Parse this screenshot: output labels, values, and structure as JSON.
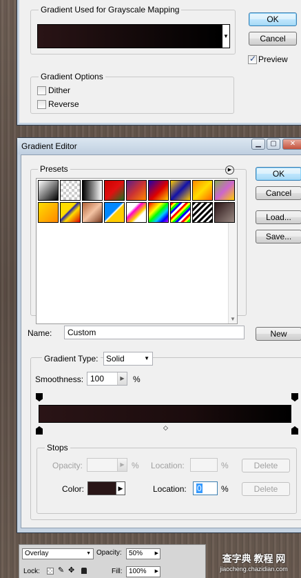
{
  "gradient_map": {
    "group_gradient": "Gradient Used for Grayscale Mapping",
    "group_options": "Gradient Options",
    "dither": "Dither",
    "reverse": "Reverse",
    "ok": "OK",
    "cancel": "Cancel",
    "preview": "Preview",
    "preview_checked": true
  },
  "gradient_editor": {
    "title": "Gradient Editor",
    "presets_label": "Presets",
    "ok": "OK",
    "cancel": "Cancel",
    "load": "Load...",
    "save": "Save...",
    "name_label": "Name:",
    "name_value": "Custom",
    "new": "New",
    "gradient_type_label": "Gradient Type:",
    "gradient_type_value": "Solid",
    "smoothness_label": "Smoothness:",
    "smoothness_value": "100",
    "percent": "%",
    "stops_label": "Stops",
    "opacity_label": "Opacity:",
    "opacity_value": "",
    "location_label": "Location:",
    "location_opacity_value": "",
    "delete": "Delete",
    "color_label": "Color:",
    "color_value": "#2a1617",
    "location_color_value": "0",
    "gradient_start": "#2a1416",
    "gradient_end": "#000000"
  },
  "presets": [
    [
      "linear-gradient(135deg,#fff 0%,#000 100%)",
      "foreground-to-transparent"
    ],
    [
      "repeating-conic-gradient(#ccc 0 25%,#fff 0 50%) 0 0/8px 8px",
      "transparent"
    ],
    [
      "linear-gradient(90deg,#000,#fff)",
      "black-white"
    ],
    [
      "linear-gradient(135deg,#c00 0%,#e01010 50%,#1f6e1f 100%)",
      "red-green"
    ],
    [
      "linear-gradient(135deg,#5a1e8a 0%,#c33 50%,#f80 100%)",
      "violet-orange"
    ],
    [
      "linear-gradient(135deg,#20a 0%,#d00 55%,#fc0 100%)",
      "blue-red-yellow"
    ],
    [
      "linear-gradient(135deg,#fc0 0%,#11a 50%,#fc0 100%)",
      "blue-yellow-blue"
    ],
    [
      "linear-gradient(135deg,#f80 0%,#fd0 50%,#f60 100%)",
      "orange-yellow"
    ],
    [
      "linear-gradient(135deg,#8a5 0%,#c6c 50%,#fc0 100%)",
      "violet-green"
    ],
    [
      "linear-gradient(135deg,#fd0 0%,#f80 100%)",
      "yellow-violet"
    ],
    [
      "linear-gradient(135deg,#fd0 0%,#fd0 40%,#22a 45%,#fd0 60%,#d00 100%)",
      "spectrum-yellow"
    ],
    [
      "linear-gradient(135deg,#b5653a 0%,#f3c2a2 50%,#7a3a20 100%)",
      "copper"
    ],
    [
      "linear-gradient(135deg,#08f 0%,#08f 45%,#fff 50%,#fc0 55%,#fc0 100%)",
      "chrome"
    ],
    [
      "linear-gradient(135deg,#fff 30%,#f0c 40%,#fc0 60%,#fff 70%)",
      "spectrum-light"
    ],
    [
      "linear-gradient(135deg,#f00,#f80,#ff0,#0f0,#0cf,#00f,#c0f)",
      "spectrum"
    ],
    [
      "repeating-linear-gradient(135deg,#f00 0 3px,#ff0 3px 6px,#0f0 6px 9px,#00f 9px 12px,#fff 12px 15px)",
      "rainbow-stripes"
    ],
    [
      "repeating-linear-gradient(135deg,#000 0 3px,#fff 3px 6px)",
      "stripes"
    ],
    [
      "linear-gradient(135deg,#2a1416 0%,#9a8a84 100%)",
      "custom"
    ]
  ],
  "layers": {
    "blend_mode": "Overlay",
    "opacity_label": "Opacity:",
    "opacity_value": "50%",
    "lock_label": "Lock:",
    "fill_label": "Fill:",
    "fill_value": "100%"
  },
  "watermark": {
    "brand": "查字典 教程 网",
    "url": "jiaocheng.chazidian.com"
  }
}
